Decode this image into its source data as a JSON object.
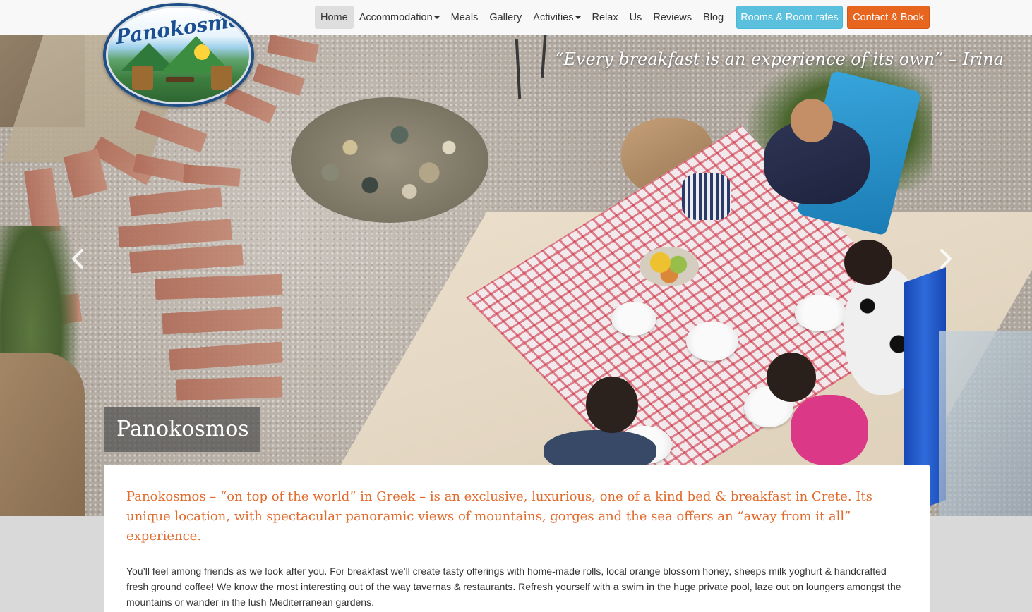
{
  "logo": {
    "title": "Panokosmos",
    "tagline": "on top of the world"
  },
  "nav": {
    "items": [
      {
        "label": "Home",
        "active": true,
        "dropdown": false
      },
      {
        "label": "Accommodation",
        "active": false,
        "dropdown": true
      },
      {
        "label": "Meals",
        "active": false,
        "dropdown": false
      },
      {
        "label": "Gallery",
        "active": false,
        "dropdown": false
      },
      {
        "label": "Activities",
        "active": false,
        "dropdown": true
      },
      {
        "label": "Relax",
        "active": false,
        "dropdown": false
      },
      {
        "label": "Us",
        "active": false,
        "dropdown": false
      },
      {
        "label": "Reviews",
        "active": false,
        "dropdown": false
      },
      {
        "label": "Blog",
        "active": false,
        "dropdown": false
      }
    ],
    "rooms_button": "Rooms & Room rates",
    "contact_button": "Contact & Book"
  },
  "hero": {
    "quote": "“Every breakfast is an experience of its own” – Irina",
    "caption": "Panokosmos",
    "prev_icon": "chevron-left-icon",
    "next_icon": "chevron-right-icon"
  },
  "content": {
    "lead": "Panokosmos – “on top of the world” in Greek – is an exclusive, luxurious, one of a kind bed & breakfast in Crete.  Its unique location, with spectacular panoramic views of mountains, gorges and the sea  offers an “away from it all” experience.",
    "body": "You’ll feel among friends as we look after you.  For breakfast  we’ll create tasty offerings with home-made rolls, local orange blossom honey, sheeps milk yoghurt & handcrafted fresh ground coffee!  We know the most interesting out of the way tavernas & restaurants. Refresh yourself with a swim in the huge private pool, laze out on loungers amongst the mountains or wander in the lush Mediterranean gardens."
  },
  "colors": {
    "accent_orange": "#e8651f",
    "accent_blue": "#5bc0de",
    "lead_text": "#e26a2c",
    "navbar_bg": "#f8f8f8"
  }
}
